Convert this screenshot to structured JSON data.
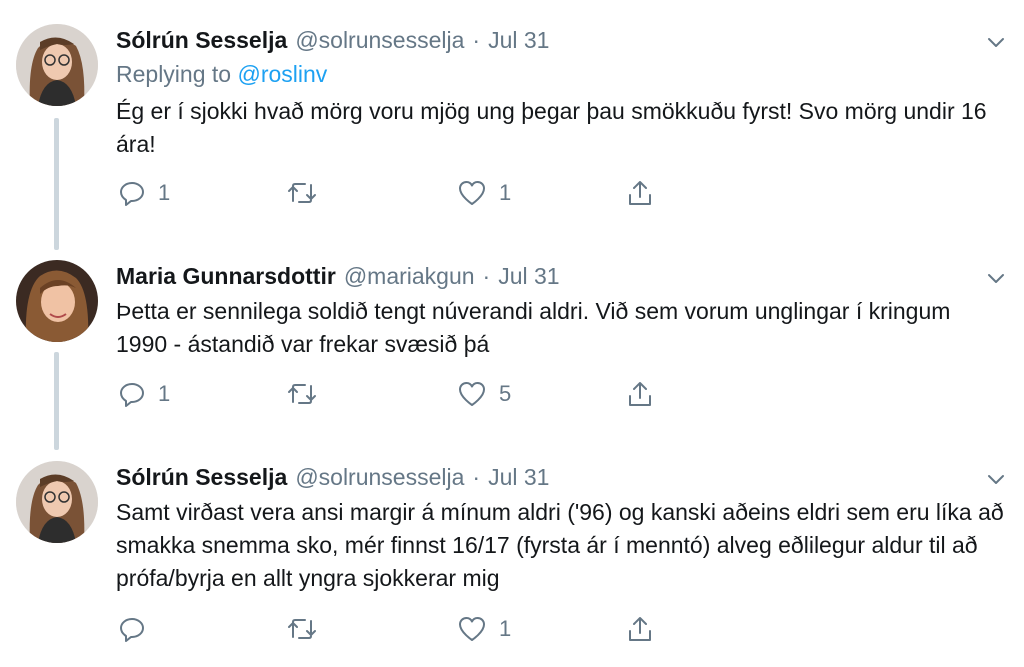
{
  "tweets": [
    {
      "name": "Sólrún Sesselja",
      "handle": "@solrunsesselja",
      "separator": "·",
      "date": "Jul 31",
      "replying_prefix": "Replying to",
      "replying_to": "@roslinv",
      "text": "Ég er í sjokki hvað mörg voru mjög ung þegar þau smökkuðu fyrst! Svo mörg undir 16 ára!",
      "reply_count": "1",
      "retweet_count": "",
      "like_count": "1"
    },
    {
      "name": "Maria Gunnarsdottir",
      "handle": "@mariakgun",
      "separator": "·",
      "date": "Jul 31",
      "text": "Þetta er sennilega soldið tengt núverandi aldri. Við sem vorum unglingar í kringum 1990 - ástandið var frekar svæsið þá",
      "reply_count": "1",
      "retweet_count": "",
      "like_count": "5"
    },
    {
      "name": "Sólrún Sesselja",
      "handle": "@solrunsesselja",
      "separator": "·",
      "date": "Jul 31",
      "text": "Samt virðast vera ansi margir á mínum aldri ('96) og kanski aðeins eldri sem eru líka að smakka snemma sko, mér finnst 16/17 (fyrsta ár í menntó) alveg eðlilegur aldur til að prófa/byrja en allt yngra sjokkerar mig",
      "reply_count": "",
      "retweet_count": "",
      "like_count": "1"
    }
  ],
  "icons": {
    "reply": "reply-icon",
    "retweet": "retweet-icon",
    "like": "heart-icon",
    "share": "share-icon",
    "more": "chevron-down-icon"
  },
  "colors": {
    "text": "#14171a",
    "secondary": "#657786",
    "link": "#1da1f2",
    "thread_line": "#ccd6dd"
  }
}
